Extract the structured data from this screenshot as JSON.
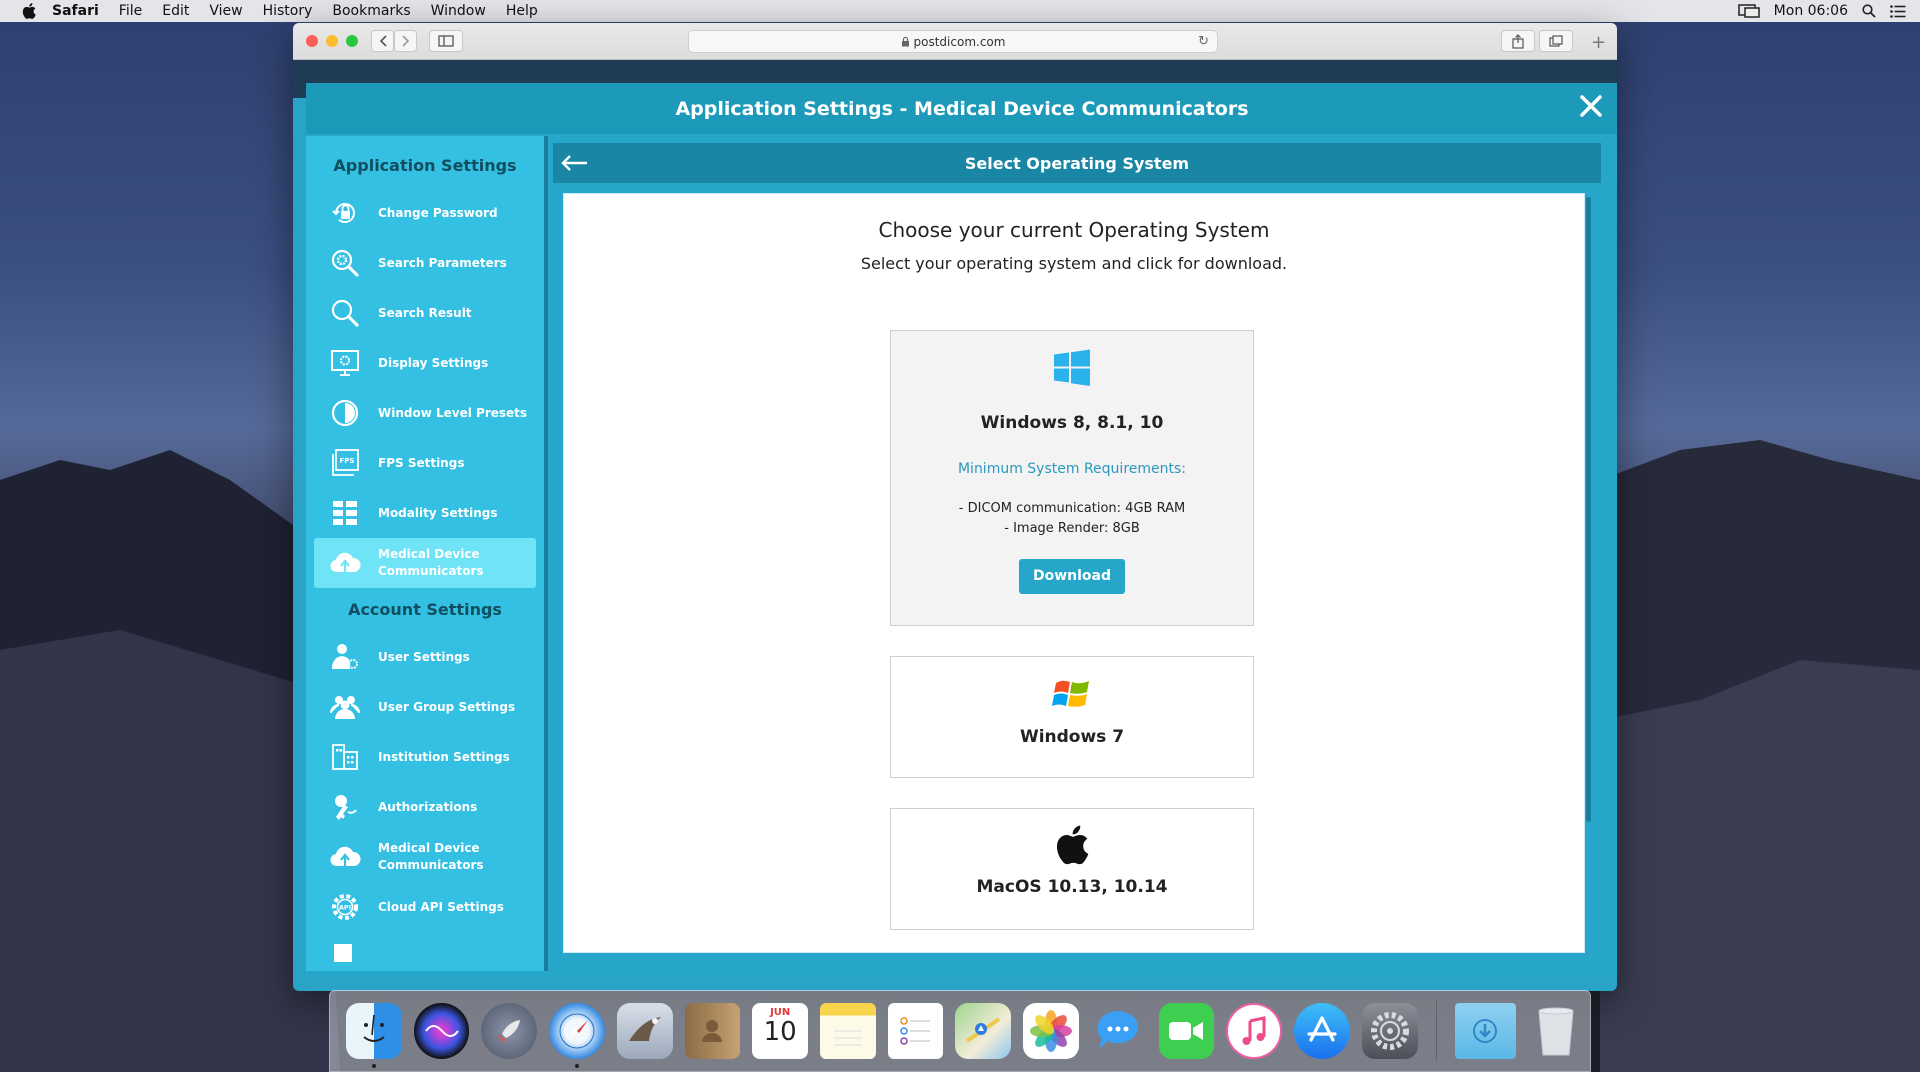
{
  "menubar": {
    "app_name": "Safari",
    "menus": [
      "File",
      "Edit",
      "View",
      "History",
      "Bookmarks",
      "Window",
      "Help"
    ],
    "clock": "Mon 06:06"
  },
  "browser": {
    "url": "postdicom.com"
  },
  "dialog": {
    "title": "Application Settings - Medical Device Communicators"
  },
  "sidebar": {
    "app_settings_heading": "Application Settings",
    "app_items": [
      {
        "label": "Change Password",
        "icon": "lock-icon"
      },
      {
        "label": "Search Parameters",
        "icon": "search-gear-icon"
      },
      {
        "label": "Search Result",
        "icon": "search-icon"
      },
      {
        "label": "Display Settings",
        "icon": "monitor-gear-icon"
      },
      {
        "label": "Window Level Presets",
        "icon": "contrast-icon"
      },
      {
        "label": "FPS Settings",
        "icon": "fps-icon"
      },
      {
        "label": "Modality Settings",
        "icon": "grid-icon"
      },
      {
        "label": "Medical Device Communicators",
        "icon": "cloud-upload-icon"
      }
    ],
    "account_settings_heading": "Account Settings",
    "account_items": [
      {
        "label": "User Settings",
        "icon": "user-gear-icon"
      },
      {
        "label": "User Group Settings",
        "icon": "users-icon"
      },
      {
        "label": "Institution Settings",
        "icon": "building-icon"
      },
      {
        "label": "Authorizations",
        "icon": "key-icon"
      },
      {
        "label": "Medical Device Communicators",
        "icon": "cloud-upload-icon"
      },
      {
        "label": "Cloud API Settings",
        "icon": "api-gear-icon"
      }
    ]
  },
  "content": {
    "header": "Select Operating System",
    "heading": "Choose your current Operating System",
    "subheading": "Select your operating system and click for download.",
    "os_options": [
      {
        "name": "Windows 8, 8.1, 10",
        "icon": "windows-10-icon",
        "requirements_title": "Minimum System Requirements:",
        "requirements": [
          "- DICOM communication: 4GB RAM",
          "- Image Render: 8GB"
        ],
        "download_label": "Download"
      },
      {
        "name": "Windows 7",
        "icon": "windows-7-icon"
      },
      {
        "name": "MacOS 10.13, 10.14",
        "icon": "apple-icon"
      }
    ]
  },
  "dock": {
    "calendar_month": "JUN",
    "calendar_day": "10",
    "apps": [
      "Finder",
      "Siri",
      "Launchpad",
      "Safari",
      "Mail",
      "Contacts",
      "Calendar",
      "Notes",
      "Reminders",
      "Maps",
      "Photos",
      "Messages",
      "FaceTime",
      "iTunes",
      "App Store",
      "System Preferences",
      "Downloads",
      "Trash"
    ]
  },
  "colors": {
    "accent": "#26a7c9",
    "sidebar": "#33c0e3",
    "active_item": "#6fe4f6",
    "header_dark": "#1a86a6"
  }
}
